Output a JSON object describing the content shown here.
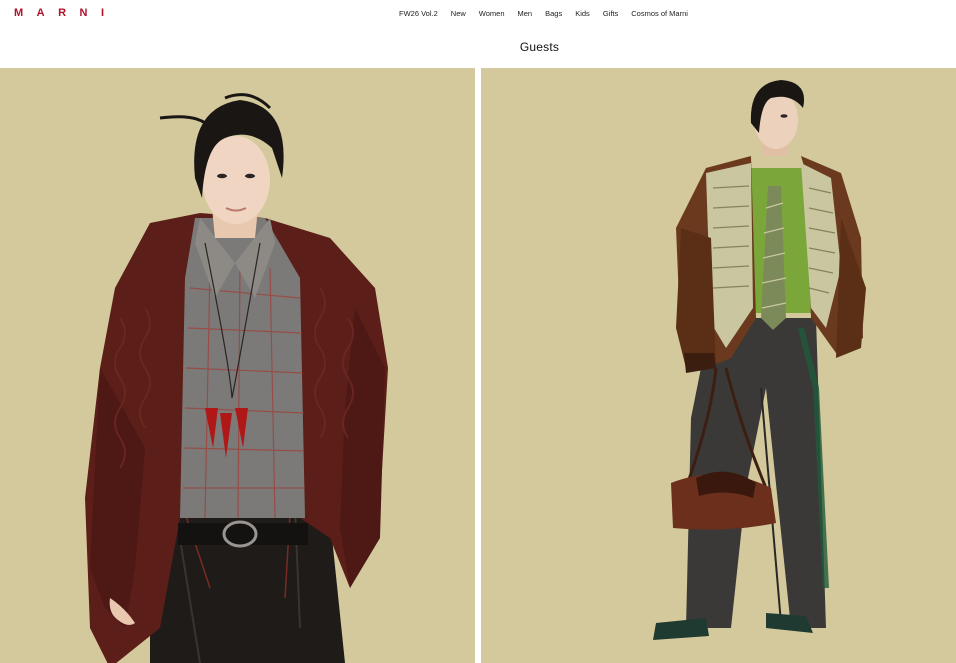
{
  "brand": {
    "logo_text": "MARNI",
    "color": "#b0122a"
  },
  "nav": {
    "items": [
      {
        "label": "FW26 Vol.2"
      },
      {
        "label": "New"
      },
      {
        "label": "Women"
      },
      {
        "label": "Men"
      },
      {
        "label": "Bags"
      },
      {
        "label": "Kids"
      },
      {
        "label": "Gifts"
      },
      {
        "label": "Cosmos of Marni"
      }
    ]
  },
  "section": {
    "title": "Guests"
  },
  "colors": {
    "backdrop": "#d3c89b",
    "page_background": "#ffffff"
  }
}
